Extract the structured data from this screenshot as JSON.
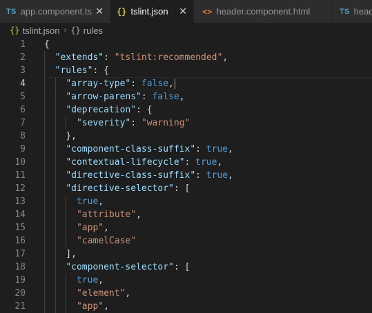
{
  "tabs": [
    {
      "icon": "TS",
      "icon_name": "typescript-file-icon",
      "label": "app.component.ts",
      "active": false,
      "close": "✕"
    },
    {
      "icon": "{}",
      "icon_name": "json-file-icon",
      "label": "tslint.json",
      "active": true,
      "close": "✕"
    },
    {
      "icon": "<>",
      "icon_name": "html-file-icon",
      "label": "header.component.html",
      "active": false
    },
    {
      "icon": "TS",
      "icon_name": "typescript-file-icon",
      "label": "head",
      "active": false
    }
  ],
  "breadcrumb": {
    "file_icon": "{}",
    "file": "tslint.json",
    "separator": "›",
    "object_icon": "{}",
    "node": "rules"
  },
  "editor": {
    "active_line": 4,
    "lines": [
      {
        "n": "1",
        "tokens": [
          {
            "t": "{",
            "c": "p"
          }
        ]
      },
      {
        "n": "2",
        "tokens": [
          {
            "t": "  "
          },
          {
            "t": "\"extends\"",
            "c": "k"
          },
          {
            "t": ": ",
            "c": "p"
          },
          {
            "t": "\"tslint:recommended\"",
            "c": "s"
          },
          {
            "t": ",",
            "c": "p"
          }
        ]
      },
      {
        "n": "3",
        "tokens": [
          {
            "t": "  "
          },
          {
            "t": "\"rules\"",
            "c": "k"
          },
          {
            "t": ": {",
            "c": "p"
          }
        ]
      },
      {
        "n": "4",
        "tokens": [
          {
            "t": "    "
          },
          {
            "t": "\"array-type\"",
            "c": "k"
          },
          {
            "t": ": ",
            "c": "p"
          },
          {
            "t": "false",
            "c": "b"
          },
          {
            "t": ",",
            "c": "p"
          }
        ],
        "cursor": true
      },
      {
        "n": "5",
        "tokens": [
          {
            "t": "    "
          },
          {
            "t": "\"arrow-parens\"",
            "c": "k"
          },
          {
            "t": ": ",
            "c": "p"
          },
          {
            "t": "false",
            "c": "b"
          },
          {
            "t": ",",
            "c": "p"
          }
        ]
      },
      {
        "n": "6",
        "tokens": [
          {
            "t": "    "
          },
          {
            "t": "\"deprecation\"",
            "c": "k"
          },
          {
            "t": ": {",
            "c": "p"
          }
        ]
      },
      {
        "n": "7",
        "tokens": [
          {
            "t": "      "
          },
          {
            "t": "\"severity\"",
            "c": "k"
          },
          {
            "t": ": ",
            "c": "p"
          },
          {
            "t": "\"warning\"",
            "c": "s"
          }
        ]
      },
      {
        "n": "8",
        "tokens": [
          {
            "t": "    "
          },
          {
            "t": "},",
            "c": "p"
          }
        ]
      },
      {
        "n": "9",
        "tokens": [
          {
            "t": "    "
          },
          {
            "t": "\"component-class-suffix\"",
            "c": "k"
          },
          {
            "t": ": ",
            "c": "p"
          },
          {
            "t": "true",
            "c": "b"
          },
          {
            "t": ",",
            "c": "p"
          }
        ]
      },
      {
        "n": "10",
        "tokens": [
          {
            "t": "    "
          },
          {
            "t": "\"contextual-lifecycle\"",
            "c": "k"
          },
          {
            "t": ": ",
            "c": "p"
          },
          {
            "t": "true",
            "c": "b"
          },
          {
            "t": ",",
            "c": "p"
          }
        ]
      },
      {
        "n": "11",
        "tokens": [
          {
            "t": "    "
          },
          {
            "t": "\"directive-class-suffix\"",
            "c": "k"
          },
          {
            "t": ": ",
            "c": "p"
          },
          {
            "t": "true",
            "c": "b"
          },
          {
            "t": ",",
            "c": "p"
          }
        ]
      },
      {
        "n": "12",
        "tokens": [
          {
            "t": "    "
          },
          {
            "t": "\"directive-selector\"",
            "c": "k"
          },
          {
            "t": ": [",
            "c": "p"
          }
        ]
      },
      {
        "n": "13",
        "tokens": [
          {
            "t": "      "
          },
          {
            "t": "true",
            "c": "b"
          },
          {
            "t": ",",
            "c": "p"
          }
        ]
      },
      {
        "n": "14",
        "tokens": [
          {
            "t": "      "
          },
          {
            "t": "\"attribute\"",
            "c": "s"
          },
          {
            "t": ",",
            "c": "p"
          }
        ]
      },
      {
        "n": "15",
        "tokens": [
          {
            "t": "      "
          },
          {
            "t": "\"app\"",
            "c": "s"
          },
          {
            "t": ",",
            "c": "p"
          }
        ]
      },
      {
        "n": "16",
        "tokens": [
          {
            "t": "      "
          },
          {
            "t": "\"camelCase\"",
            "c": "s"
          }
        ]
      },
      {
        "n": "17",
        "tokens": [
          {
            "t": "    "
          },
          {
            "t": "],",
            "c": "p"
          }
        ]
      },
      {
        "n": "18",
        "tokens": [
          {
            "t": "    "
          },
          {
            "t": "\"component-selector\"",
            "c": "k"
          },
          {
            "t": ": [",
            "c": "p"
          }
        ]
      },
      {
        "n": "19",
        "tokens": [
          {
            "t": "      "
          },
          {
            "t": "true",
            "c": "b"
          },
          {
            "t": ",",
            "c": "p"
          }
        ]
      },
      {
        "n": "20",
        "tokens": [
          {
            "t": "      "
          },
          {
            "t": "\"element\"",
            "c": "s"
          },
          {
            "t": ",",
            "c": "p"
          }
        ]
      },
      {
        "n": "21",
        "tokens": [
          {
            "t": "      "
          },
          {
            "t": "\"app\"",
            "c": "s"
          },
          {
            "t": ",",
            "c": "p"
          }
        ]
      }
    ]
  },
  "colors": {
    "background": "#1e1e1e",
    "tab_inactive": "#2d2d2d",
    "key": "#9cdcfe",
    "string": "#ce9178",
    "boolean": "#569cd6",
    "punctuation": "#d4d4d4"
  }
}
